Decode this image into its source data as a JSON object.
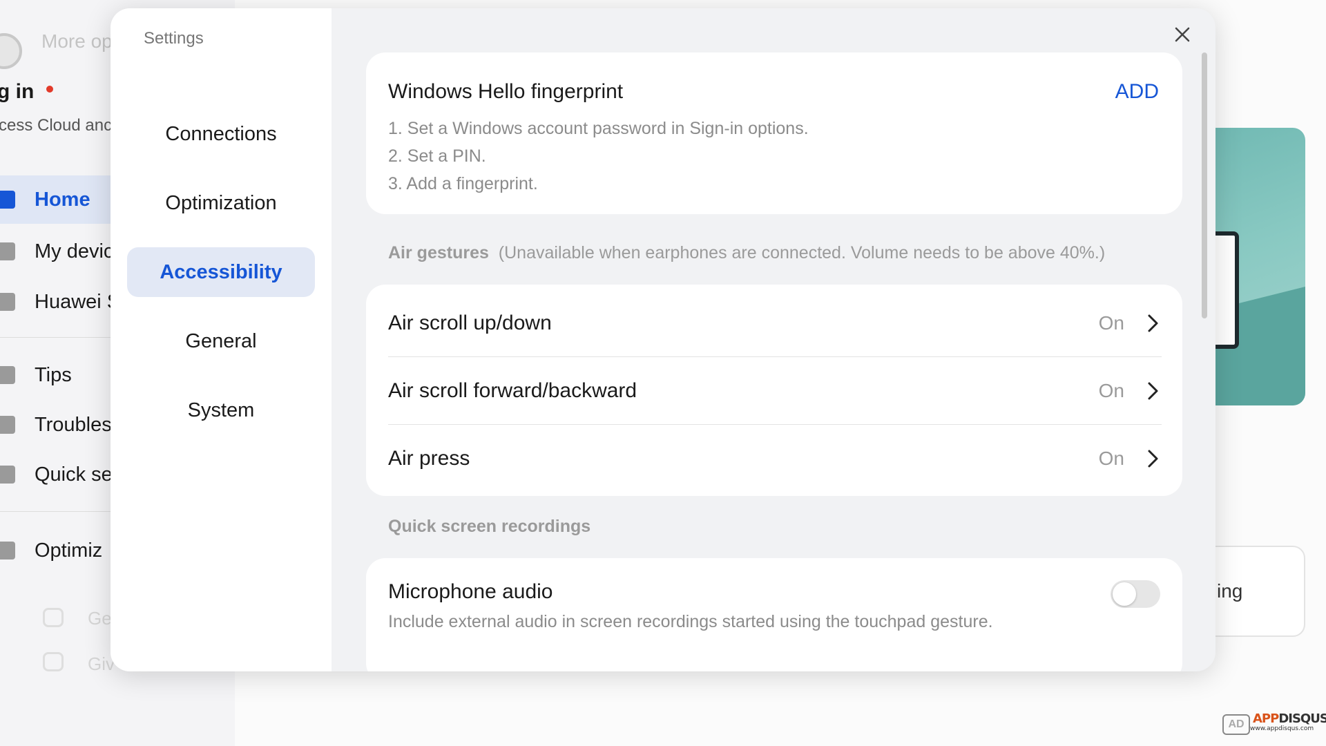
{
  "background": {
    "more_options": "More op",
    "login": "g in",
    "login_sub": "cess Cloud anc",
    "nav": [
      {
        "label": "Home",
        "active": true,
        "icon": "laptop-icon"
      },
      {
        "label": "My devic",
        "active": false,
        "icon": "devices-icon"
      },
      {
        "label": "Huawei S",
        "active": false,
        "icon": "broadcast-icon"
      },
      {
        "label": "Tips",
        "active": false,
        "icon": "tips-icon"
      },
      {
        "label": "Troubles",
        "active": false,
        "icon": "wrench-icon"
      },
      {
        "label": "Quick se",
        "active": false,
        "icon": "shield-icon"
      },
      {
        "label": "Optimiz",
        "active": false,
        "icon": "upload-icon"
      }
    ],
    "faded_links": [
      "Ge",
      "Giv"
    ],
    "right_card_text": "ing",
    "watermark": {
      "brand": "APP",
      "brand2": "DISQUS",
      "url": "www.appdisqus.com",
      "logo": "AD"
    }
  },
  "dialog": {
    "title": "Settings",
    "close_icon": "close-icon",
    "menu": [
      {
        "label": "Connections",
        "active": false
      },
      {
        "label": "Optimization",
        "active": false
      },
      {
        "label": "Accessibility",
        "active": true
      },
      {
        "label": "General",
        "active": false
      },
      {
        "label": "System",
        "active": false
      }
    ],
    "fingerprint": {
      "title": "Windows Hello fingerprint",
      "action": "ADD",
      "steps": [
        "1. Set a Windows account password in Sign-in options.",
        "2. Set a PIN.",
        "3. Add a fingerprint."
      ]
    },
    "air_gestures": {
      "label": "Air gestures",
      "note": "(Unavailable when earphones are connected. Volume needs to be above 40%.)",
      "items": [
        {
          "title": "Air scroll up/down",
          "value": "On"
        },
        {
          "title": "Air scroll forward/backward",
          "value": "On"
        },
        {
          "title": "Air press",
          "value": "On"
        }
      ]
    },
    "screen_recordings": {
      "label": "Quick screen recordings",
      "microphone": {
        "title": "Microphone audio",
        "description": "Include external audio in screen recordings started using the touchpad gesture.",
        "enabled": false
      }
    }
  }
}
